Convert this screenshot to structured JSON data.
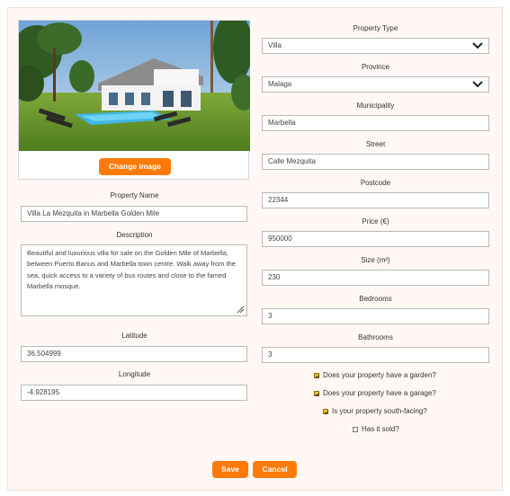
{
  "photo": {
    "button_label": "Change image"
  },
  "left": {
    "property_name": {
      "label": "Property Name",
      "value": "Villa La Mezquita in Marbella Golden Mile"
    },
    "description": {
      "label": "Description",
      "value": "Beautiful and luxurious villa for sale on the Golden Mile of Marbella, between Puerto Banus and Marbella town centre. Walk away from the sea, quick access to a variety of bus routes and close to the famed Marbella mosque."
    },
    "latitude": {
      "label": "Latitude",
      "value": "36.504999"
    },
    "longitude": {
      "label": "Longitude",
      "value": "-4.928195"
    }
  },
  "right": {
    "property_type": {
      "label": "Property Type",
      "value": "Villa"
    },
    "province": {
      "label": "Province",
      "value": "Malaga"
    },
    "municipality": {
      "label": "Municipality",
      "value": "Marbella"
    },
    "street": {
      "label": "Street",
      "value": "Calle Mezquita"
    },
    "postcode": {
      "label": "Postcode",
      "value": "22344"
    },
    "price": {
      "label": "Price (€)",
      "value": "950000"
    },
    "size": {
      "label": "Size (m²)",
      "value": "230"
    },
    "bedrooms": {
      "label": "Bedrooms",
      "value": "3"
    },
    "bathrooms": {
      "label": "Bathrooms",
      "value": "3"
    }
  },
  "checks": {
    "garden": {
      "label": "Does your property have a garden?",
      "checked": true
    },
    "garage": {
      "label": "Does your property have a garage?",
      "checked": true
    },
    "south": {
      "label": "Is your property south-facing?",
      "checked": true
    },
    "sold": {
      "label": "Has it sold?",
      "checked": false
    }
  },
  "actions": {
    "save": "Save",
    "cancel": "Cancel"
  },
  "colors": {
    "accent": "#ff7a06",
    "checkbox": "#f3c414",
    "panel_bg": "#fff8f5"
  }
}
